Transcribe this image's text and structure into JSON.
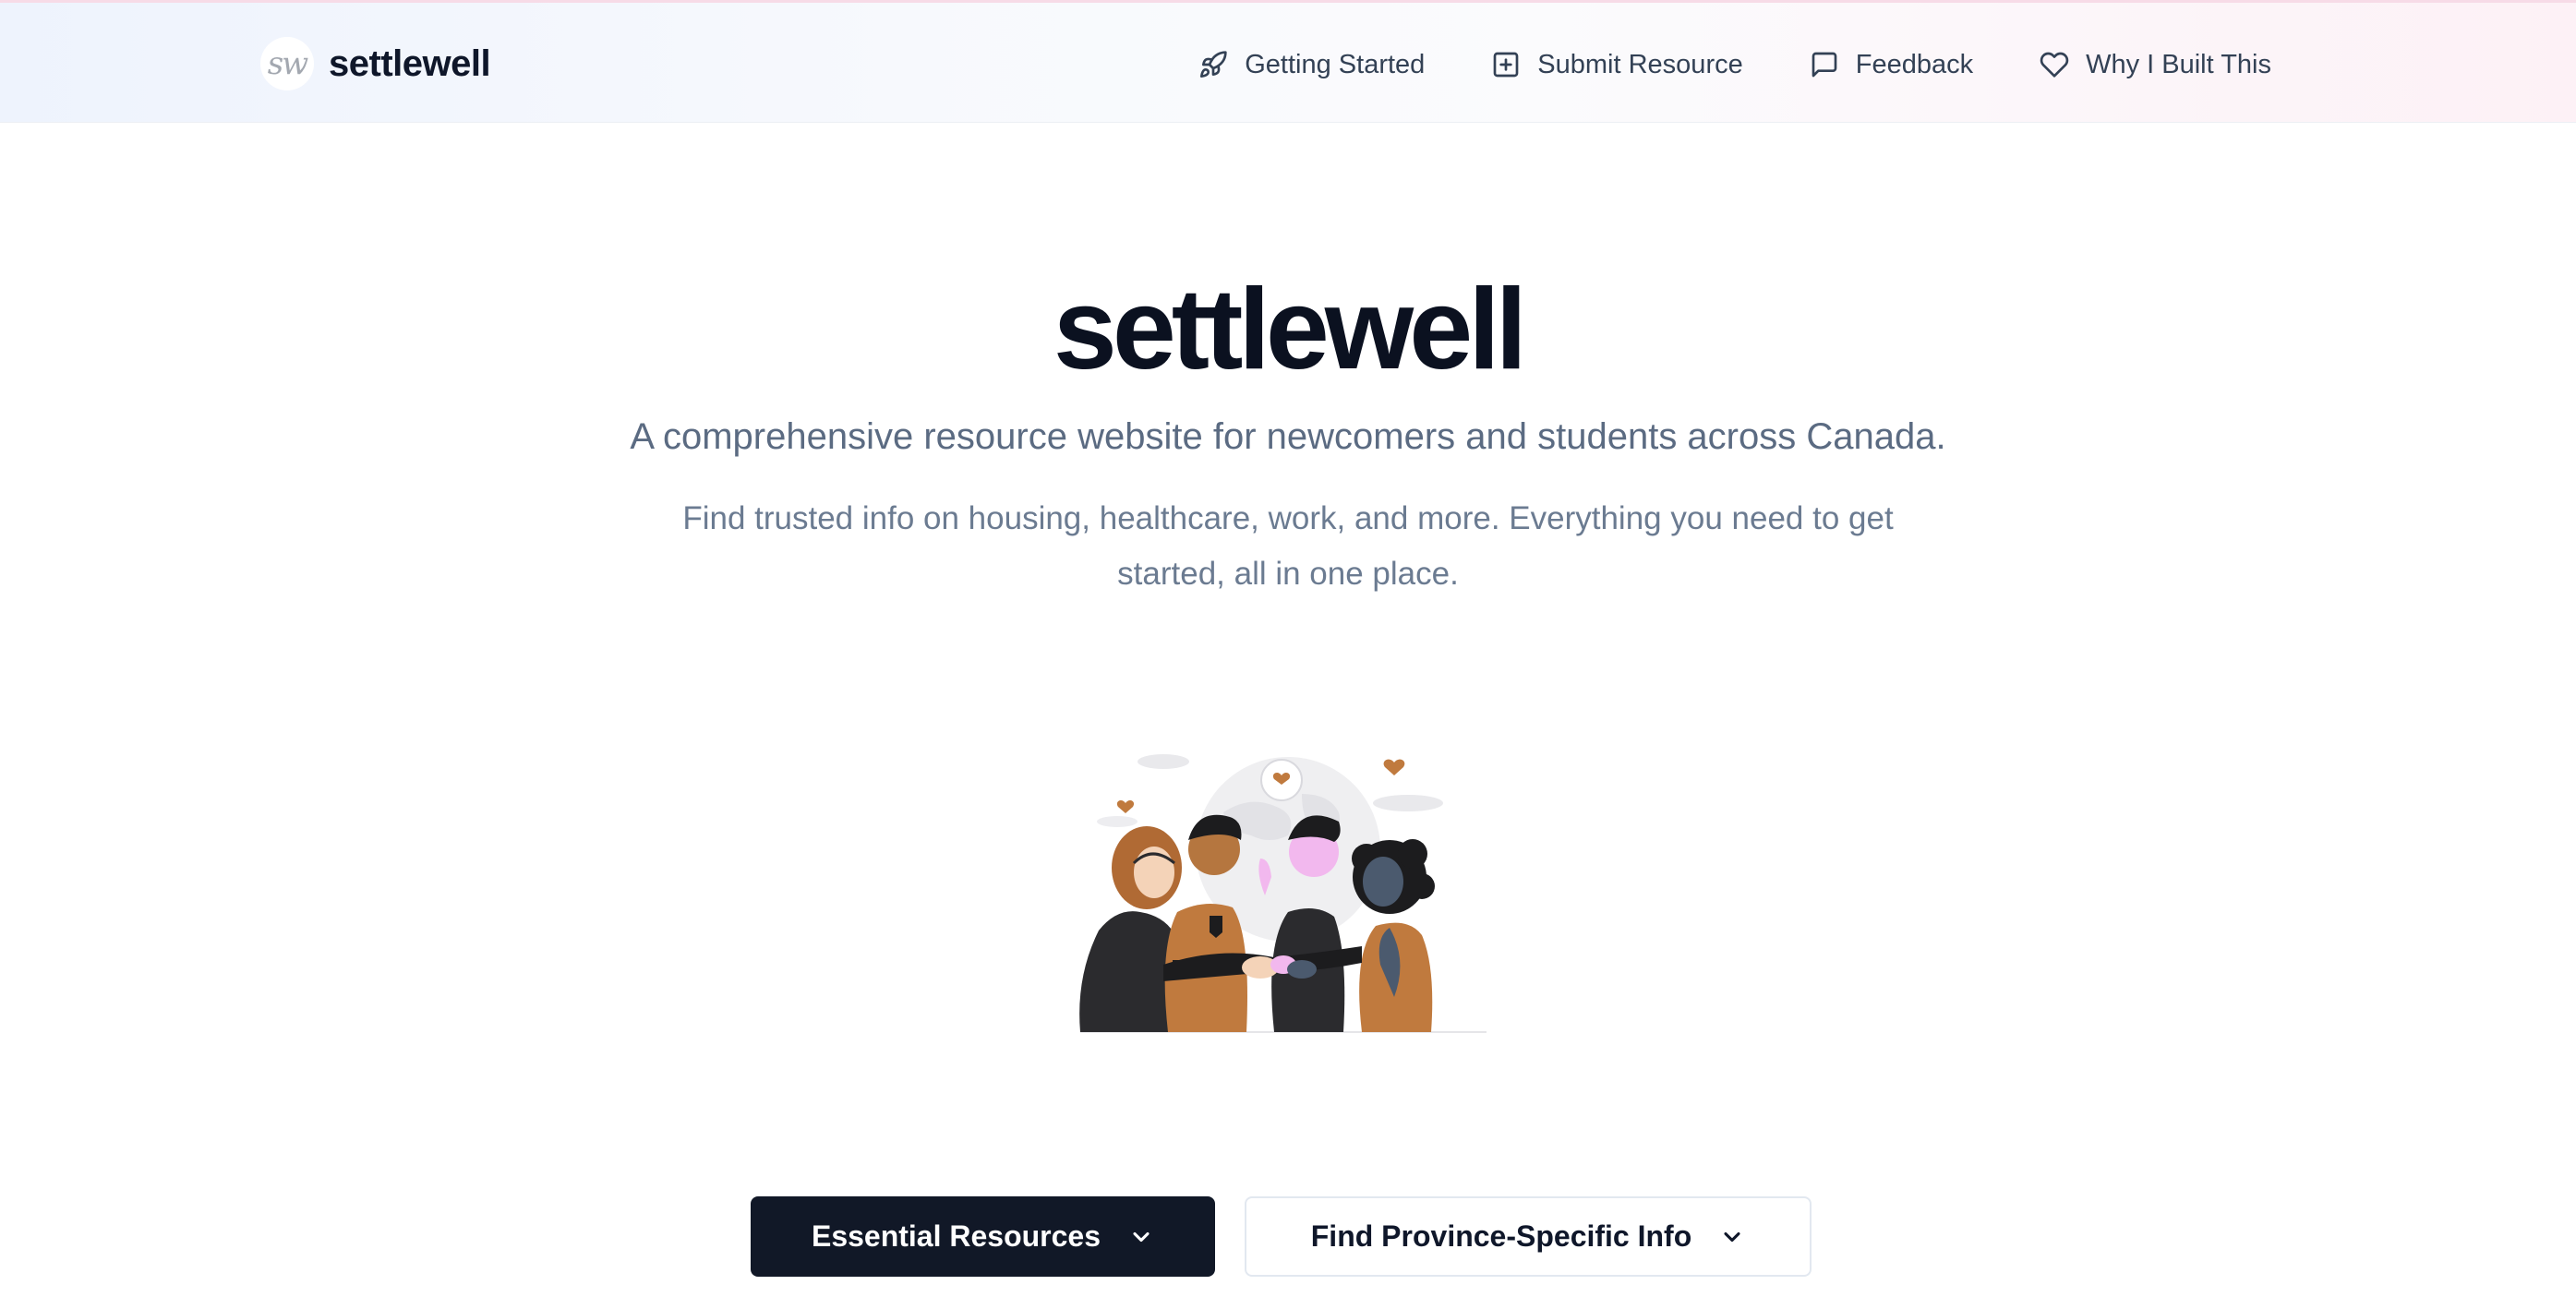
{
  "header": {
    "brand_logo_text": "sw",
    "brand_name": "settlewell",
    "nav": [
      {
        "label": "Getting Started",
        "icon": "rocket-icon"
      },
      {
        "label": "Submit Resource",
        "icon": "plus-square-icon"
      },
      {
        "label": "Feedback",
        "icon": "message-square-icon"
      },
      {
        "label": "Why I Built This",
        "icon": "heart-icon"
      }
    ]
  },
  "hero": {
    "title": "settlewell",
    "subtitle": "A comprehensive resource website for newcomers and students across Canada.",
    "description": "Find trusted info on housing, healthcare, work, and more. Everything you need to get started, all in one place."
  },
  "illustration": {
    "icon": "community-people-illustration"
  },
  "actions": {
    "primary_label": "Essential Resources",
    "secondary_label": "Find Province-Specific Info"
  },
  "colors": {
    "primary_button": "#111827",
    "text_dark": "#0f172a",
    "text_muted": "#5b6b82",
    "accent_orange": "#c07a3e",
    "accent_pink": "#f2b8ee"
  }
}
